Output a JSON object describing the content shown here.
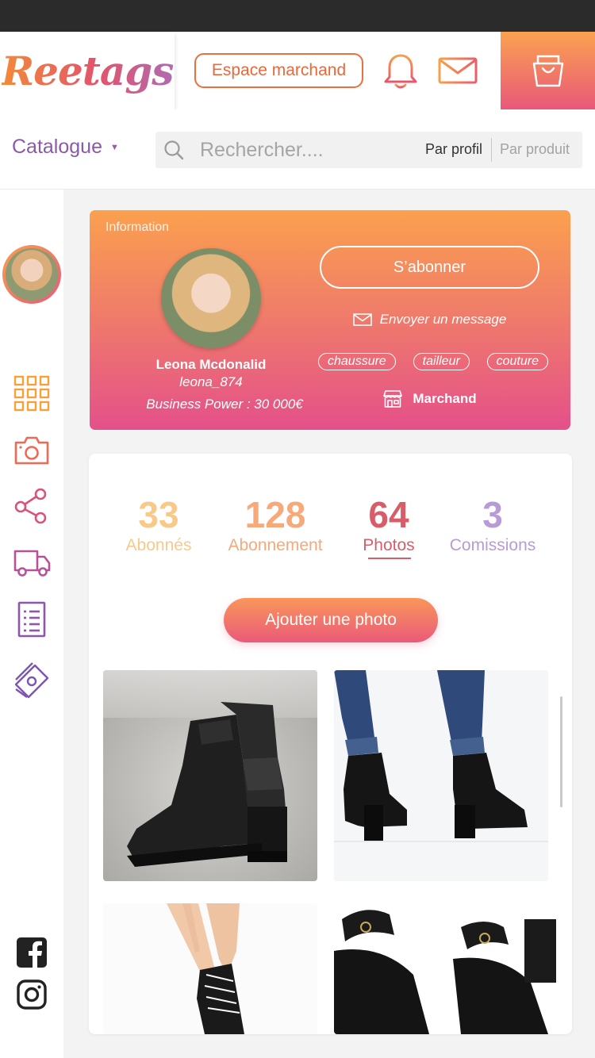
{
  "header": {
    "logo_text": "Reetags",
    "merchant_button": "Espace marchand",
    "icons": [
      "bell-icon",
      "mail-icon",
      "shopping-bag-icon"
    ]
  },
  "search": {
    "catalogue_label": "Catalogue",
    "placeholder": "Rechercher....",
    "filter_profile": "Par profil",
    "filter_product": "Par produit"
  },
  "sidebar": {
    "icons": [
      "grid-icon",
      "camera-icon",
      "share-icon",
      "truck-icon",
      "document-list-icon",
      "money-icon"
    ],
    "social": [
      "facebook-icon",
      "instagram-icon"
    ]
  },
  "profile": {
    "section_label": "Information",
    "name": "Leona Mcdonalid",
    "handle": "leona_874",
    "business_power": "Business Power : 30 000€",
    "subscribe_button": "S’abonner",
    "send_message": "Envoyer un message",
    "tags": [
      "chaussure",
      "tailleur",
      "couture"
    ],
    "role": "Marchand"
  },
  "stats": [
    {
      "value": "33",
      "label": "Abonnés",
      "color": "#f9c98a"
    },
    {
      "value": "128",
      "label": "Abonnement",
      "color": "#f7a97a"
    },
    {
      "value": "64",
      "label": "Photos",
      "color": "#d95d69"
    },
    {
      "value": "3",
      "label": "Comissions",
      "color": "#b89bd6"
    }
  ],
  "add_photo_button": "Ajouter une photo",
  "colors": {
    "accent_orange": "#fba04e",
    "accent_pink": "#e4508a",
    "purple": "#8a5aa8"
  }
}
